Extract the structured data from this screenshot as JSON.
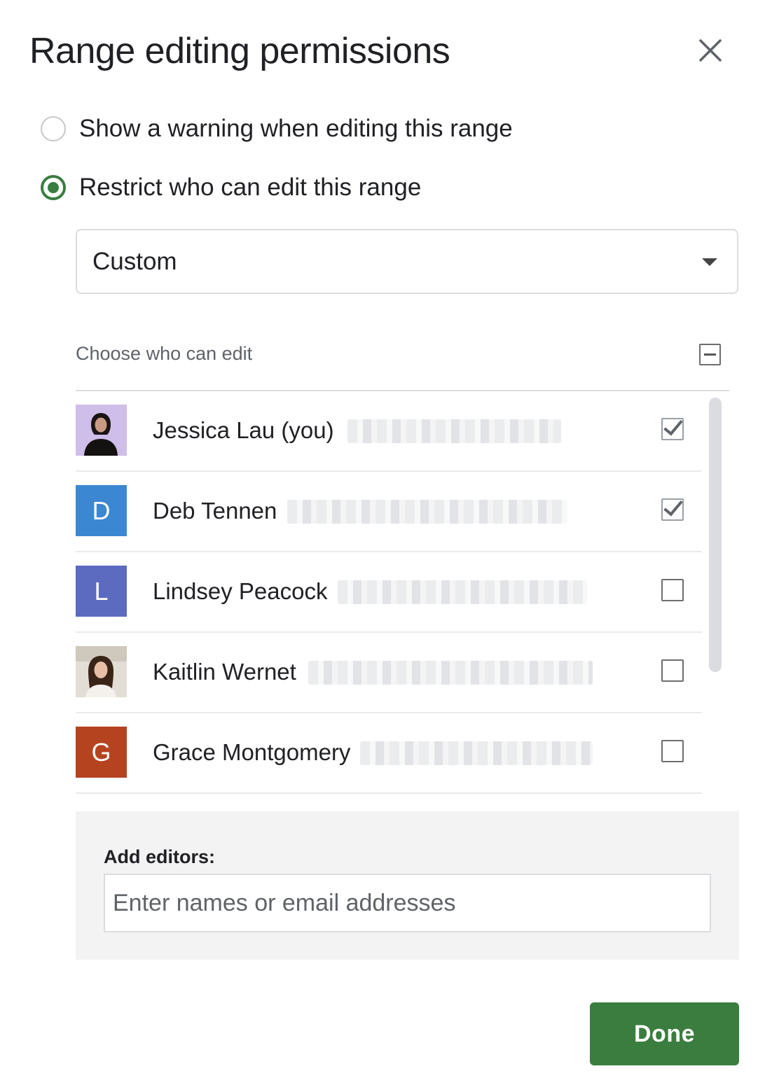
{
  "dialog": {
    "title": "Range editing permissions",
    "close_icon": "close-icon"
  },
  "options": [
    {
      "label": "Show a warning when editing this range",
      "selected": false
    },
    {
      "label": "Restrict who can edit this range",
      "selected": true
    }
  ],
  "dropdown": {
    "value": "Custom",
    "icon": "arrow-drop-down-icon"
  },
  "editors_header": {
    "label": "Choose who can edit",
    "toggle_state": "indeterminate"
  },
  "editors": [
    {
      "name": "Jessica Lau (you)",
      "avatar": "photo",
      "avatar_color": "#c9b8e8",
      "checked": true
    },
    {
      "name": "Deb Tennen",
      "avatar": "D",
      "avatar_color": "#3c87d1",
      "checked": true
    },
    {
      "name": "Lindsey Peacock",
      "avatar": "L",
      "avatar_color": "#5c6bc0",
      "checked": false
    },
    {
      "name": "Kaitlin Wernet",
      "avatar": "photo",
      "avatar_color": "#ddd6cc",
      "checked": false
    },
    {
      "name": "Grace Montgomery",
      "avatar": "G",
      "avatar_color": "#b5431f",
      "checked": false
    }
  ],
  "add_editors": {
    "label": "Add editors:",
    "placeholder": "Enter names or email addresses"
  },
  "done_button": {
    "label": "Done",
    "color": "#3b7d3f"
  }
}
